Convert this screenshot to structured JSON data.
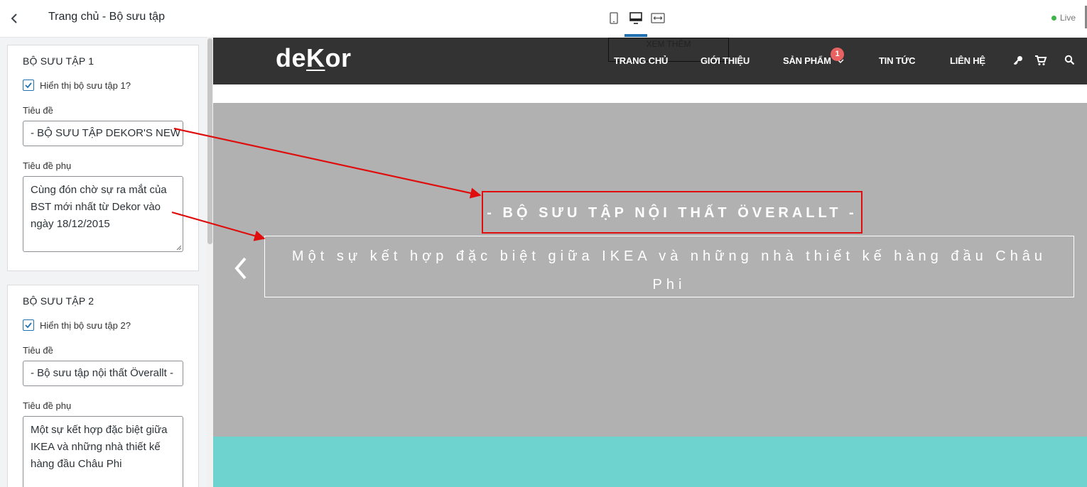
{
  "sidebar": {
    "title": "Trang chủ - Bộ sưu tập",
    "sections": [
      {
        "heading": "BỘ SƯU TẬP 1",
        "show_label": "Hiển thị bộ sưu tập 1?",
        "show_checked": true,
        "title_label": "Tiêu đề",
        "title_value": "- BỘ SƯU TẬP DEKOR'S NEW",
        "subtitle_label": "Tiêu đề phụ",
        "subtitle_value": "Cùng đón chờ sự ra mắt của BST mới nhất từ Dekor vào ngày 18/12/2015"
      },
      {
        "heading": "BỘ SƯU TẬP 2",
        "show_label": "Hiển thị bộ sưu tập 2?",
        "show_checked": true,
        "title_label": "Tiêu đề",
        "title_value": "- Bộ sưu tập nội thất Överallt -",
        "subtitle_label": "Tiêu đề phụ",
        "subtitle_value": "Một sự kết hợp đặc biệt giữa IKEA và những nhà thiết kế hàng đầu Châu Phi"
      }
    ]
  },
  "preview": {
    "devices": [
      "tablet-icon",
      "desktop-icon",
      "fullwidth-icon"
    ],
    "active_device": "desktop",
    "live_label": "Live",
    "site": {
      "logo": {
        "pre": "de",
        "k": "K",
        "post": "or"
      },
      "xem_them": "XEM THÊM",
      "nav": [
        "TRANG CHỦ",
        "GIỚI THIỆU",
        "SẢN PHẨM",
        "TIN TỨC",
        "LIÊN HỆ"
      ],
      "cart_count": "1",
      "banner_title": "- BỘ SƯU TẬP NỘI THẤT ÖVERALLT -",
      "banner_subtitle": "Một sự kết hợp đặc biệt giữa IKEA và những nhà thiết kế hàng đầu Châu Phi"
    }
  },
  "colors": {
    "banner_bg": "#b1b1b1",
    "navbar_bg": "#333333",
    "teal_strip": "#6ed3cf",
    "annotation_red": "#e00d0d",
    "accent_blue": "#2271b1"
  }
}
